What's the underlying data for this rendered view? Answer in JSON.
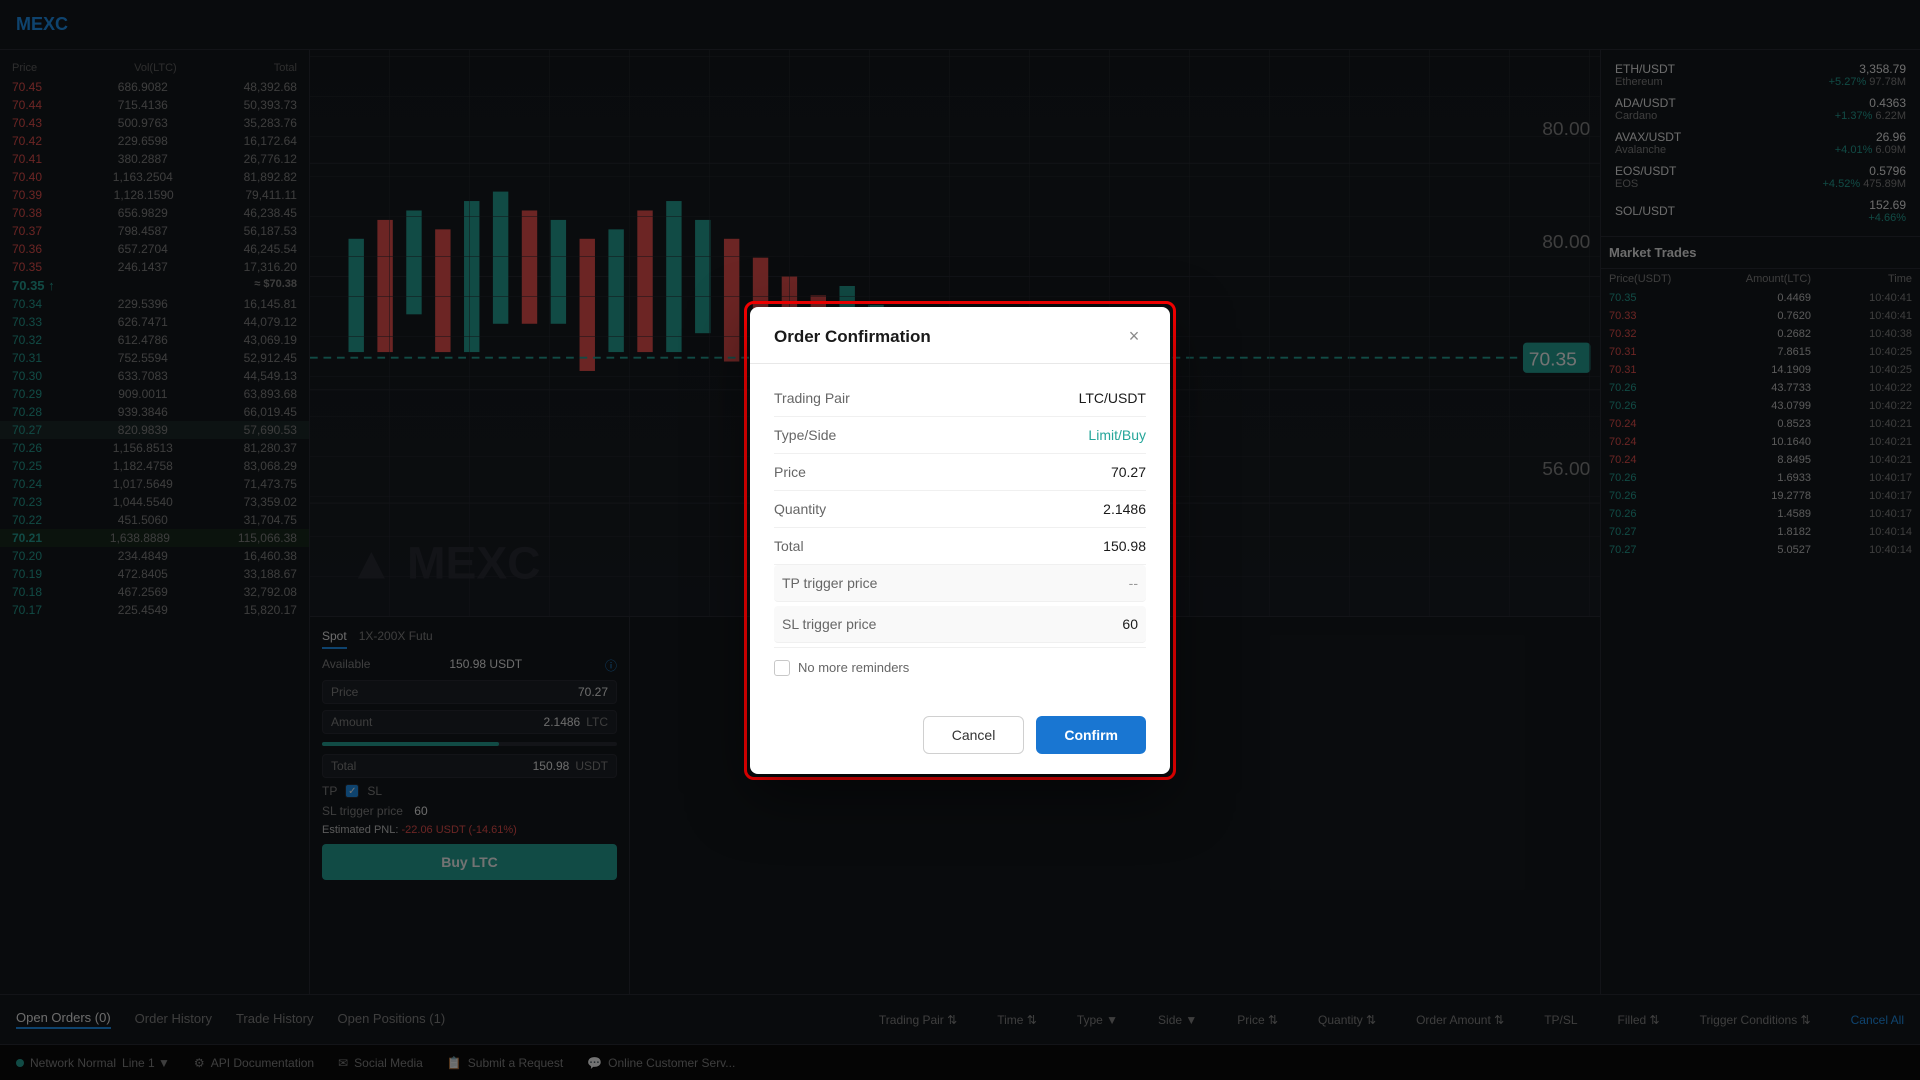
{
  "modal": {
    "title": "Order Confirmation",
    "close_icon": "×",
    "rows": [
      {
        "label": "Trading Pair",
        "value": "LTC/USDT",
        "type": "normal"
      },
      {
        "label": "Type/Side",
        "value": "Limit/Buy",
        "type": "buy"
      },
      {
        "label": "Price",
        "value": "70.27",
        "type": "normal"
      },
      {
        "label": "Quantity",
        "value": "2.1486",
        "type": "normal"
      },
      {
        "label": "Total",
        "value": "150.98",
        "type": "normal"
      },
      {
        "label": "TP trigger price",
        "value": "--",
        "type": "dash"
      },
      {
        "label": "SL trigger price",
        "value": "60",
        "type": "normal"
      }
    ],
    "reminder": {
      "label": "No more reminders",
      "checked": false
    },
    "cancel_label": "Cancel",
    "confirm_label": "Confirm"
  },
  "orderbook": {
    "headers": [
      "Price",
      "Vol(LTC)",
      "Total"
    ],
    "sell_rows": [
      {
        "price": "70.45",
        "vol": "686.9082",
        "total": "48,392.68"
      },
      {
        "price": "70.44",
        "vol": "715.4136",
        "total": "50,393.73"
      },
      {
        "price": "70.43",
        "vol": "500.9763",
        "total": "35,283.76"
      },
      {
        "price": "70.42",
        "vol": "229.6598",
        "total": "16,172.64"
      },
      {
        "price": "70.41",
        "vol": "380.2887",
        "total": "26,776.12"
      },
      {
        "price": "70.40",
        "vol": "1,163.2504",
        "total": "81,892.82"
      },
      {
        "price": "70.39",
        "vol": "1,128.1590",
        "total": "79,411.11"
      },
      {
        "price": "70.38",
        "vol": "656.9829",
        "total": "46,238.45"
      },
      {
        "price": "70.37",
        "vol": "798.4587",
        "total": "56,187.53"
      },
      {
        "price": "70.36",
        "vol": "657.2704",
        "total": "46,245.54"
      },
      {
        "price": "70.35",
        "vol": "246.1437",
        "total": "17,316.20"
      }
    ],
    "current_price": "70.35",
    "current_arrow": "↑",
    "current_compare": "≈ $70.38",
    "buy_rows": [
      {
        "price": "70.34",
        "vol": "229.5396",
        "total": "16,145.81"
      },
      {
        "price": "70.33",
        "vol": "626.7471",
        "total": "44,079.12"
      },
      {
        "price": "70.32",
        "vol": "612.4786",
        "total": "43,069.19"
      },
      {
        "price": "70.31",
        "vol": "752.5594",
        "total": "52,912.45"
      },
      {
        "price": "70.30",
        "vol": "633.7083",
        "total": "44,549.13"
      },
      {
        "price": "70.29",
        "vol": "909.0011",
        "total": "63,893.68"
      },
      {
        "price": "70.28",
        "vol": "939.3846",
        "total": "66,019.45"
      },
      {
        "price": "70.27",
        "vol": "820.9839",
        "total": "57,690.53"
      },
      {
        "price": "70.26",
        "vol": "1,156.8513",
        "total": "81,280.37"
      },
      {
        "price": "70.25",
        "vol": "1,182.4758",
        "total": "83,068.29"
      },
      {
        "price": "70.24",
        "vol": "1,017.5649",
        "total": "71,473.75"
      },
      {
        "price": "70.23",
        "vol": "1,044.5540",
        "total": "73,359.02"
      },
      {
        "price": "70.22",
        "vol": "451.5060",
        "total": "31,704.75"
      },
      {
        "price": "70.21",
        "vol": "1,638.8889",
        "total": "115,066.38"
      },
      {
        "price": "70.20",
        "vol": "234.4849",
        "total": "16,460.38"
      },
      {
        "price": "70.19",
        "vol": "472.8405",
        "total": "33,188.67"
      },
      {
        "price": "70.18",
        "vol": "467.2569",
        "total": "32,792.08"
      },
      {
        "price": "70.17",
        "vol": "225.4549",
        "total": "15,820.17"
      }
    ]
  },
  "trade_form": {
    "tabs": [
      "Spot",
      "1X-200X Futu"
    ],
    "active_tab": "Spot",
    "available": "150.98 USDT",
    "price_label": "Price",
    "price_value": "70.27",
    "amount_label": "Amount",
    "amount_value": "2.1486",
    "total_label": "Total",
    "total_value": "150.98",
    "tp_label": "TP",
    "sl_label": "SL",
    "sl_trigger_label": "SL trigger price",
    "sl_trigger_value": "60",
    "pnl_label": "Estimated PNL:",
    "pnl_value": "-22.06 USDT (-14.61%)",
    "buy_button": "Buy LTC"
  },
  "right_panel": {
    "cryptos": [
      {
        "pair": "ETH/USDT",
        "name": "Ethereum",
        "price": "3,358.79",
        "change": "+5.27%",
        "vol": "97.78M",
        "positive": true
      },
      {
        "pair": "ADA/USDT",
        "name": "Cardano",
        "price": "0.4363",
        "change": "+1.37%",
        "vol": "6.22M",
        "positive": true
      },
      {
        "pair": "AVAX/USDT",
        "name": "Avalanche",
        "price": "26.96",
        "change": "+4.01%",
        "vol": "6.09M",
        "positive": true
      },
      {
        "pair": "EOS/USDT",
        "name": "EOS",
        "price": "0.5796",
        "change": "+4.52%",
        "vol": "475.89M",
        "positive": true
      },
      {
        "pair": "SOL/USDT",
        "name": "",
        "price": "152.69",
        "change": "+4.66%",
        "vol": "",
        "positive": true
      }
    ],
    "market_trades_title": "Market Trades",
    "mt_headers": [
      "Price(USDT)",
      "Amount(LTC)",
      "Time"
    ],
    "trades": [
      {
        "price": "70.35",
        "amount": "0.4469",
        "time": "10:40:41",
        "side": "buy"
      },
      {
        "price": "70.33",
        "amount": "0.7620",
        "time": "10:40:41",
        "side": "sell"
      },
      {
        "price": "70.32",
        "amount": "0.2682",
        "time": "10:40:38",
        "side": "sell"
      },
      {
        "price": "70.31",
        "amount": "7.8615",
        "time": "10:40:25",
        "side": "sell"
      },
      {
        "price": "70.31",
        "amount": "14.1909",
        "time": "10:40:25",
        "side": "sell"
      },
      {
        "price": "70.26",
        "amount": "43.7733",
        "time": "10:40:22",
        "side": "buy"
      },
      {
        "price": "70.26",
        "amount": "43.0799",
        "time": "10:40:22",
        "side": "buy"
      },
      {
        "price": "70.24",
        "amount": "0.8523",
        "time": "10:40:21",
        "side": "sell"
      },
      {
        "price": "70.24",
        "amount": "10.1640",
        "time": "10:40:21",
        "side": "sell"
      },
      {
        "price": "70.24",
        "amount": "8.8495",
        "time": "10:40:21",
        "side": "sell"
      },
      {
        "price": "70.26",
        "amount": "1.6933",
        "time": "10:40:17",
        "side": "buy"
      },
      {
        "price": "70.26",
        "amount": "19.2778",
        "time": "10:40:17",
        "side": "buy"
      },
      {
        "price": "70.26",
        "amount": "1.4589",
        "time": "10:40:17",
        "side": "buy"
      },
      {
        "price": "70.27",
        "amount": "1.8182",
        "time": "10:40:14",
        "side": "buy"
      },
      {
        "price": "70.27",
        "amount": "5.0527",
        "time": "10:40:14",
        "side": "buy"
      }
    ]
  },
  "bottom_tabs": [
    "Open Orders (0)",
    "Order History",
    "Trade History",
    "Open Positions (1)"
  ],
  "bottom_columns": [
    "Trading Pair",
    "Time",
    "Type",
    "Side",
    "Price",
    "Quantity",
    "Order Amount",
    "TP/SL",
    "Filled",
    "Trigger Conditions",
    "Cancel All"
  ],
  "status_bar": {
    "network": "Network Normal",
    "line": "Line 1",
    "api_docs": "API Documentation",
    "social": "Social Media",
    "submit": "Submit a Request",
    "customer": "Online Customer Serv..."
  }
}
